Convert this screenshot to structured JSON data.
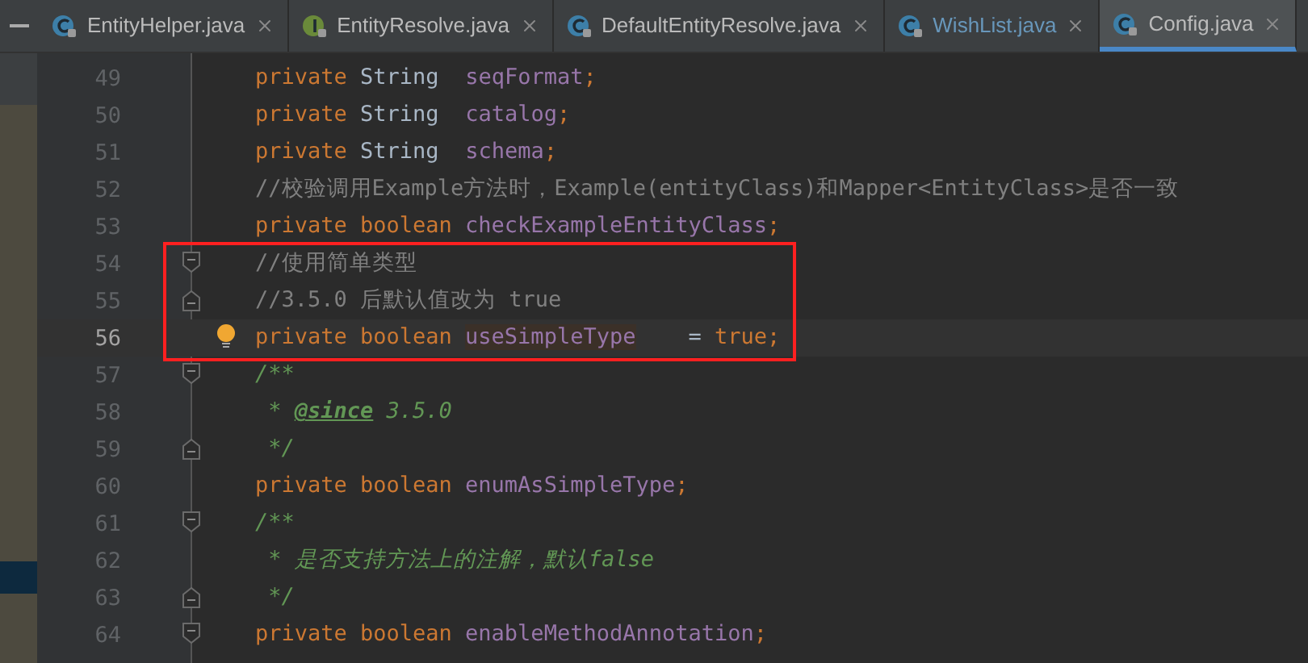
{
  "tabs": [
    {
      "label": "EntityHelper.java",
      "kind": "class",
      "color": "#bbbbbb",
      "selected": false
    },
    {
      "label": "EntityResolve.java",
      "kind": "interface",
      "color": "#bbbbbb",
      "selected": false
    },
    {
      "label": "DefaultEntityResolve.java",
      "kind": "class",
      "color": "#bbbbbb",
      "selected": false
    },
    {
      "label": "WishList.java",
      "kind": "class",
      "color": "#6897bb",
      "selected": false
    },
    {
      "label": "Config.java",
      "kind": "class",
      "color": "#bbbbbb",
      "selected": true
    }
  ],
  "lines": [
    {
      "number": "49",
      "tokens": [
        {
          "kind": "keyword",
          "text": "private "
        },
        {
          "kind": "type",
          "text": "String  "
        },
        {
          "kind": "field",
          "text": "seqFormat"
        },
        {
          "kind": "keyword",
          "text": ";"
        }
      ]
    },
    {
      "number": "50",
      "tokens": [
        {
          "kind": "keyword",
          "text": "private "
        },
        {
          "kind": "type",
          "text": "String  "
        },
        {
          "kind": "field",
          "text": "catalog"
        },
        {
          "kind": "keyword",
          "text": ";"
        }
      ]
    },
    {
      "number": "51",
      "tokens": [
        {
          "kind": "keyword",
          "text": "private "
        },
        {
          "kind": "type",
          "text": "String  "
        },
        {
          "kind": "field",
          "text": "schema"
        },
        {
          "kind": "keyword",
          "text": ";"
        }
      ]
    },
    {
      "number": "52",
      "tokens": [
        {
          "kind": "comment",
          "text": "//校验调用Example方法时，Example(entityClass)和Mapper<EntityClass>是否一致"
        }
      ]
    },
    {
      "number": "53",
      "tokens": [
        {
          "kind": "keyword",
          "text": "private boolean "
        },
        {
          "kind": "field",
          "text": "checkExampleEntityClass"
        },
        {
          "kind": "keyword",
          "text": ";"
        }
      ]
    },
    {
      "number": "54",
      "fold_start": true,
      "boxed": true,
      "tokens": [
        {
          "kind": "comment",
          "text": "//使用简单类型"
        }
      ]
    },
    {
      "number": "55",
      "fold_end": true,
      "boxed": true,
      "tokens": [
        {
          "kind": "comment",
          "text": "//3.5.0 后默认值改为 true"
        }
      ]
    },
    {
      "number": "56",
      "current": true,
      "bulb": true,
      "boxed": true,
      "tokens": [
        {
          "kind": "keyword",
          "text": "private boolean "
        },
        {
          "kind": "field",
          "text": "useSimpleType",
          "marked": true
        },
        {
          "kind": "type",
          "text": "    = "
        },
        {
          "kind": "keyword",
          "text": "true;"
        }
      ]
    },
    {
      "number": "57",
      "fold_start": true,
      "tokens": [
        {
          "kind": "doc",
          "text": "/**"
        }
      ]
    },
    {
      "number": "58",
      "tokens": [
        {
          "kind": "doc",
          "text": " * "
        },
        {
          "kind": "doctag",
          "text": "@since"
        },
        {
          "kind": "doc",
          "text": " 3.5.0"
        }
      ]
    },
    {
      "number": "59",
      "fold_end": true,
      "tokens": [
        {
          "kind": "doc",
          "text": " */"
        }
      ]
    },
    {
      "number": "60",
      "tokens": [
        {
          "kind": "keyword",
          "text": "private boolean "
        },
        {
          "kind": "field",
          "text": "enumAsSimpleType"
        },
        {
          "kind": "keyword",
          "text": ";"
        }
      ]
    },
    {
      "number": "61",
      "fold_start": true,
      "tokens": [
        {
          "kind": "doc",
          "text": "/**"
        }
      ]
    },
    {
      "number": "62",
      "tokens": [
        {
          "kind": "doc",
          "text": " * 是否支持方法上的注解，默认false"
        }
      ]
    },
    {
      "number": "63",
      "fold_end": true,
      "tokens": [
        {
          "kind": "doc",
          "text": " */"
        }
      ]
    },
    {
      "number": "64",
      "fold_start": true,
      "tokens": [
        {
          "kind": "keyword",
          "text": "private boolean "
        },
        {
          "kind": "field",
          "text": "enableMethodAnnotation"
        },
        {
          "kind": "keyword",
          "text": ";"
        }
      ]
    }
  ]
}
